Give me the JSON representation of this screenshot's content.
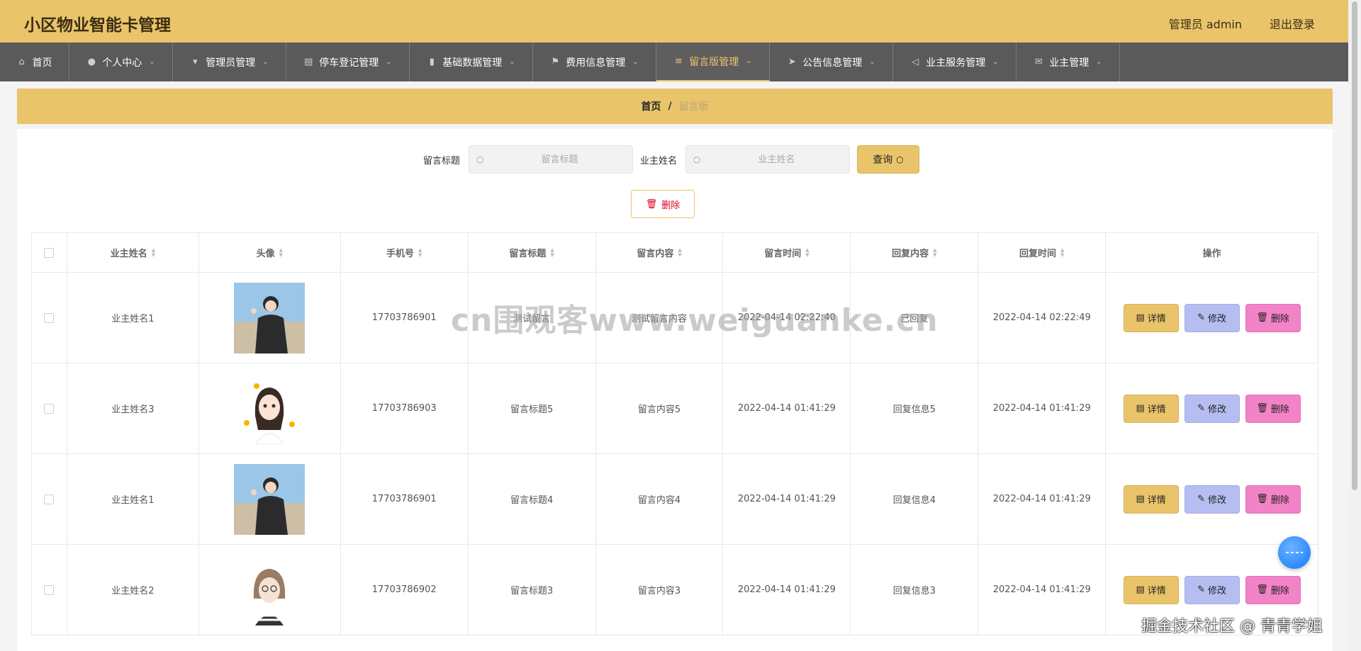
{
  "header": {
    "title": "小区物业智能卡管理",
    "user": "管理员 admin",
    "logout": "退出登录"
  },
  "nav": {
    "items": [
      {
        "label": "首页",
        "icon": "home-icon"
      },
      {
        "label": "个人中心",
        "icon": "user-icon"
      },
      {
        "label": "管理员管理",
        "icon": "cup-icon"
      },
      {
        "label": "停车登记管理",
        "icon": "chat-icon"
      },
      {
        "label": "基础数据管理",
        "icon": "bar-chart-icon"
      },
      {
        "label": "费用信息管理",
        "icon": "flag-icon"
      },
      {
        "label": "留言版管理",
        "icon": "menu-icon",
        "active": true
      },
      {
        "label": "公告信息管理",
        "icon": "send-icon"
      },
      {
        "label": "业主服务管理",
        "icon": "navigation-icon"
      },
      {
        "label": "业主管理",
        "icon": "mail-icon"
      }
    ]
  },
  "breadcrumb": {
    "home": "首页",
    "separator": "/",
    "current": "留言版"
  },
  "search": {
    "title_label": "留言标题",
    "title_placeholder": "留言标题",
    "owner_label": "业主姓名",
    "owner_placeholder": "业主姓名",
    "query_label": "查询"
  },
  "toolbar": {
    "delete_label": "删除"
  },
  "table": {
    "columns": [
      "业主姓名",
      "头像",
      "手机号",
      "留言标题",
      "留言内容",
      "留言时间",
      "回复内容",
      "回复时间",
      "操作"
    ],
    "rows": [
      {
        "owner": "业主姓名1",
        "avatar": "boy",
        "phone": "17703786901",
        "title": "测试留言",
        "content": "测试留言内容",
        "time": "2022-04-14 02:22:40",
        "reply": "已回复",
        "reply_time": "2022-04-14 02:22:49"
      },
      {
        "owner": "业主姓名3",
        "avatar": "girl",
        "phone": "17703786903",
        "title": "留言标题5",
        "content": "留言内容5",
        "time": "2022-04-14 01:41:29",
        "reply": "回复信息5",
        "reply_time": "2022-04-14 01:41:29"
      },
      {
        "owner": "业主姓名1",
        "avatar": "boy",
        "phone": "17703786901",
        "title": "留言标题4",
        "content": "留言内容4",
        "time": "2022-04-14 01:41:29",
        "reply": "回复信息4",
        "reply_time": "2022-04-14 01:41:29"
      },
      {
        "owner": "业主姓名2",
        "avatar": "sketch",
        "phone": "17703786902",
        "title": "留言标题3",
        "content": "留言内容3",
        "time": "2022-04-14 01:41:29",
        "reply": "回复信息3",
        "reply_time": "2022-04-14 01:41:29"
      }
    ],
    "actions": {
      "detail": "详情",
      "edit": "修改",
      "delete": "删除"
    }
  },
  "watermark": "cn围观客www.weiguanke.cn",
  "watermark_corner": "掘金技术社区 @ 青青学姐",
  "colors": {
    "accent": "#e9c46a",
    "nav": "#5b5a5b",
    "edit": "#b6bdf0",
    "delete": "#f383c7"
  }
}
